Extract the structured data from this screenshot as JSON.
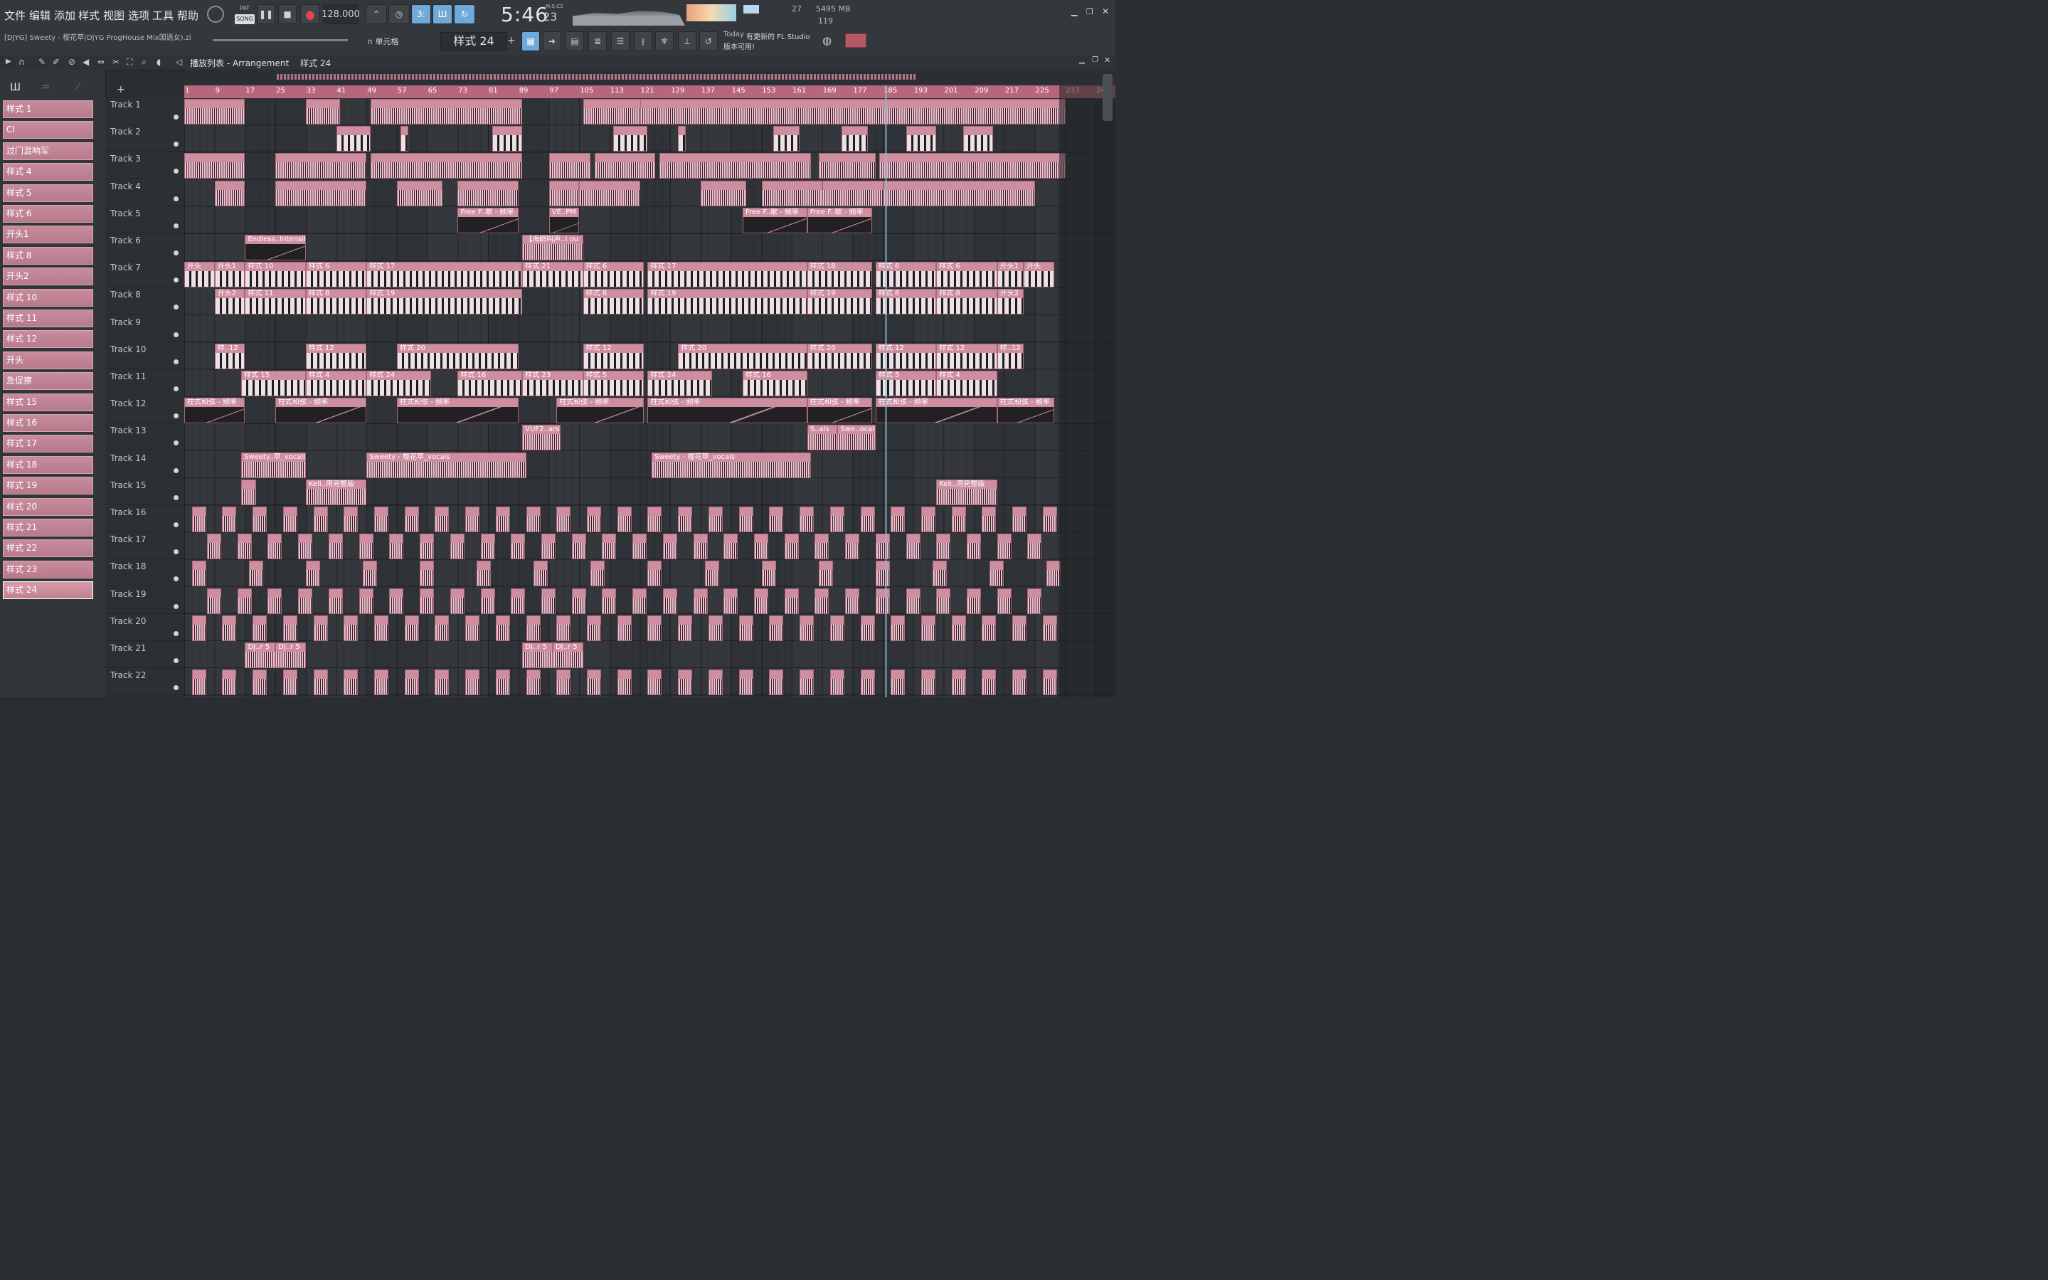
{
  "menu": [
    "文件",
    "编辑",
    "添加",
    "样式",
    "视图",
    "选项",
    "工具",
    "帮助"
  ],
  "transport": {
    "pat": "PAT",
    "song": "SONG",
    "tempo": "128.000",
    "time": "5:46",
    "time_sub": "23",
    "mscs": "M:S:CS"
  },
  "status": {
    "mem": "5495 MB",
    "cpu": "119",
    "voices": "27",
    "news_prefix": "Today",
    "news": "有更新的 FL Studio",
    "news2": "版本可用!"
  },
  "project": {
    "filename": "[DJYG] Sweety - 樱花草(DjYG ProgHouse Mix国语女).zip"
  },
  "snap": {
    "label": "单元格"
  },
  "pattern_selector": {
    "label": "样式 24"
  },
  "playlist": {
    "title": "播放列表 - Arrangement",
    "crumb": "样式 24"
  },
  "picker_tabs": {
    "a": "音符",
    "b": "通道",
    "c": "样式"
  },
  "patterns": [
    "样式 1",
    "CI",
    "过门混响军",
    "样式 4",
    "样式 5",
    "样式 6",
    "开头1",
    "样式 8",
    "开头2",
    "样式 10",
    "样式 11",
    "样式 12",
    "开头",
    "急促擦",
    "样式 15",
    "样式 16",
    "样式 17",
    "样式 18",
    "样式 19",
    "样式 20",
    "样式 21",
    "样式 22",
    "样式 23",
    "样式 24"
  ],
  "selected_pattern": "样式 24",
  "tracks": [
    "Track 1",
    "Track 2",
    "Track 3",
    "Track 4",
    "Track 5",
    "Track 6",
    "Track 7",
    "Track 8",
    "Track 9",
    "Track 10",
    "Track 11",
    "Track 12",
    "Track 13",
    "Track 14",
    "Track 15",
    "Track 16",
    "Track 17",
    "Track 18",
    "Track 19",
    "Track 20",
    "Track 21",
    "Track 22"
  ],
  "ruler": [
    "1",
    "9",
    "17",
    "25",
    "33",
    "41",
    "49",
    "57",
    "65",
    "73",
    "81",
    "89",
    "97",
    "105",
    "113",
    "121",
    "129",
    "137",
    "145",
    "153",
    "161",
    "169",
    "177",
    "185",
    "193",
    "201",
    "209",
    "217",
    "225",
    "233",
    "241"
  ],
  "clip_labels": {
    "t5a": "Free F..歌 - 频率",
    "t5b": "VE..PM",
    "t5c": "Free F..歌 - 频率",
    "t5d": "Free F..歌 - 频率",
    "t6a": "Endless..Intensit",
    "t6b": "【海鸥叫声..l ou",
    "t7": [
      "开头",
      "开头1",
      "样式 10",
      "样式 6",
      "样式 17",
      "样式 21",
      "样式 6",
      "样式 17",
      "样式 18",
      "样式 6",
      "样式 6",
      "开头1",
      "开头"
    ],
    "t8": [
      "开头2",
      "样式 11",
      "样式 8",
      "样式 19",
      "样式 8",
      "样式 19",
      "样式 19",
      "样式 8",
      "样式 8",
      "开头2"
    ],
    "t10": [
      "样..12",
      "样式 12",
      "样式 20",
      "样式 12",
      "样式 20",
      "样式 20",
      "样式 12",
      "样式 12",
      "样..12"
    ],
    "t11": [
      "样式 15",
      "样式 4",
      "样式 24",
      "样式 16",
      "样式 23",
      "样式 5",
      "样式 24",
      "样式 16",
      "样式 5",
      "样式 4"
    ],
    "t12": "柱式和弦 - 频率",
    "t13a": "VUF2..ars",
    "t13b": "S..als",
    "t13c": "Swe..ocals",
    "t14a": "Sweety..草_vocals",
    "t14b": "Sweety - 樱花草_vocals",
    "t14c": "Sweety - 樱花草_vocals",
    "t15a": "Keli..用完整版",
    "t15b": "Keli..用完整版",
    "t21": "DJ..r 5"
  },
  "colors": {
    "accent": "#6fa9d9",
    "clip": "#cf8ea0",
    "ruler": "#b7677b"
  }
}
